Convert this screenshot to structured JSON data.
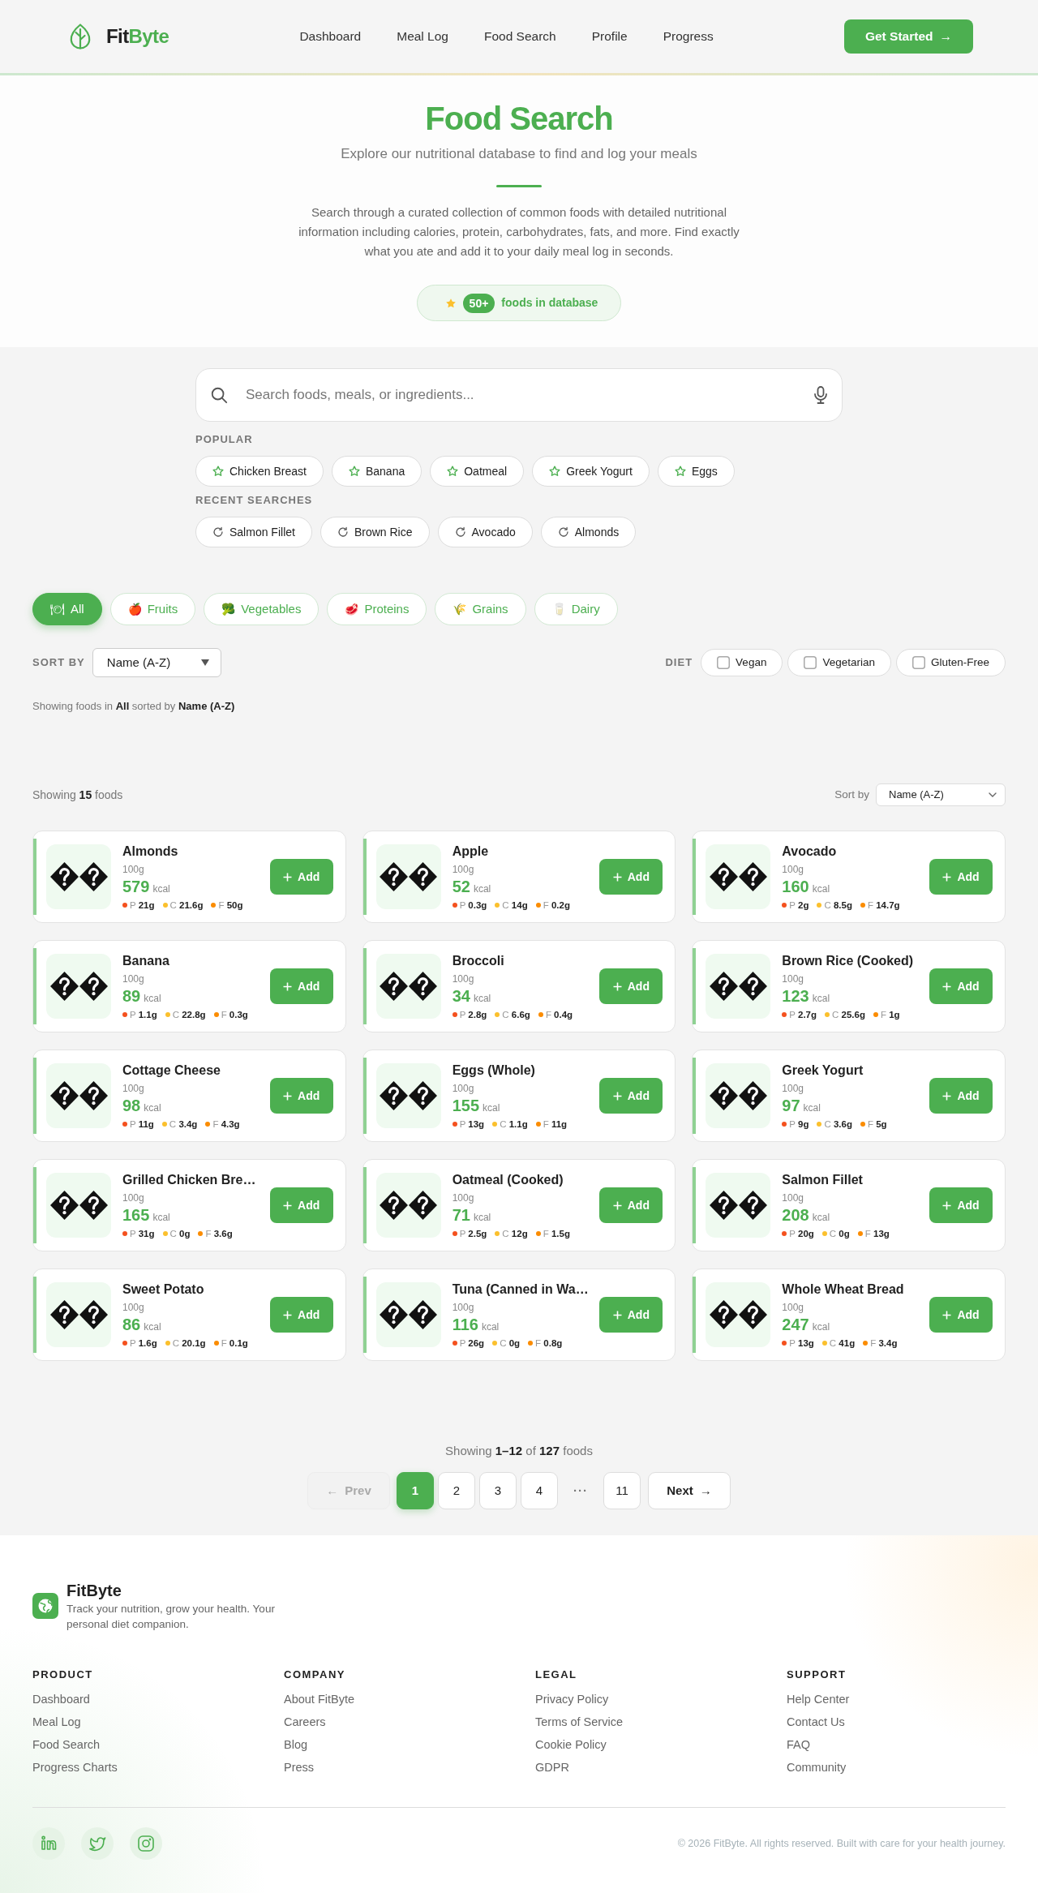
{
  "navbar": {
    "brand": {
      "prefix": "Fit",
      "accent": "Byte"
    },
    "links": [
      "Dashboard",
      "Meal Log",
      "Food Search",
      "Profile",
      "Progress"
    ],
    "cta": {
      "label": "Get Started",
      "arrow": "→"
    }
  },
  "hero": {
    "title": "Food Search",
    "subtitle": "Explore our nutritional database to find and log your meals",
    "description": "Search through a curated collection of common foods with detailed nutritional information including calories, protein, carbohydrates, fats, and more. Find exactly what you ate and add it to your daily meal log in seconds.",
    "badge": {
      "count": "50+",
      "label": "foods in database"
    }
  },
  "search": {
    "placeholder": "Search foods, meals, or ingredients..."
  },
  "popular": {
    "heading": "POPULAR",
    "items": [
      "Chicken Breast",
      "Banana",
      "Oatmeal",
      "Greek Yogurt",
      "Eggs"
    ]
  },
  "recent": {
    "heading": "RECENT SEARCHES",
    "items": [
      "Salmon Fillet",
      "Brown Rice",
      "Avocado",
      "Almonds"
    ]
  },
  "categories": [
    {
      "emoji": "🍽",
      "label": "All",
      "selected": true
    },
    {
      "emoji": "🍎",
      "label": "Fruits",
      "selected": false
    },
    {
      "emoji": "🥦",
      "label": "Vegetables",
      "selected": false
    },
    {
      "emoji": "🥩",
      "label": "Proteins",
      "selected": false
    },
    {
      "emoji": "🌾",
      "label": "Grains",
      "selected": false
    },
    {
      "emoji": "🥛",
      "label": "Dairy",
      "selected": false
    }
  ],
  "sort": {
    "label": "SORT BY",
    "value": "Name (A-Z)"
  },
  "diet": {
    "label": "DIET",
    "options": [
      {
        "label": "Vegan",
        "checked": false
      },
      {
        "label": "Vegetarian",
        "checked": false
      },
      {
        "label": "Gluten-Free",
        "checked": false
      }
    ]
  },
  "summary": "Showing foods in **All** sorted by **Name (A-Z)**",
  "results": {
    "count": "Showing **15** foods",
    "sort_label": "Sort by",
    "sort_value": "Name (A-Z)"
  },
  "foods": [
    {
      "name": "Almonds",
      "serving": "100g",
      "kcal": "579",
      "unit": "kcal",
      "macros": [
        {
          "label": "P",
          "value": "21g",
          "color": "#f4511e"
        },
        {
          "label": "C",
          "value": "21.6g",
          "color": "#fbc02d"
        },
        {
          "label": "F",
          "value": "50g",
          "color": "#fb8c00"
        }
      ],
      "action": "Add"
    },
    {
      "name": "Apple",
      "serving": "100g",
      "kcal": "52",
      "unit": "kcal",
      "macros": [
        {
          "label": "P",
          "value": "0.3g",
          "color": "#f4511e"
        },
        {
          "label": "C",
          "value": "14g",
          "color": "#fbc02d"
        },
        {
          "label": "F",
          "value": "0.2g",
          "color": "#fb8c00"
        }
      ],
      "action": "Add"
    },
    {
      "name": "Avocado",
      "serving": "100g",
      "kcal": "160",
      "unit": "kcal",
      "macros": [
        {
          "label": "P",
          "value": "2g",
          "color": "#f4511e"
        },
        {
          "label": "C",
          "value": "8.5g",
          "color": "#fbc02d"
        },
        {
          "label": "F",
          "value": "14.7g",
          "color": "#fb8c00"
        }
      ],
      "action": "Add"
    },
    {
      "name": "Banana",
      "serving": "100g",
      "kcal": "89",
      "unit": "kcal",
      "macros": [
        {
          "label": "P",
          "value": "1.1g",
          "color": "#f4511e"
        },
        {
          "label": "C",
          "value": "22.8g",
          "color": "#fbc02d"
        },
        {
          "label": "F",
          "value": "0.3g",
          "color": "#fb8c00"
        }
      ],
      "action": "Add"
    },
    {
      "name": "Broccoli",
      "serving": "100g",
      "kcal": "34",
      "unit": "kcal",
      "macros": [
        {
          "label": "P",
          "value": "2.8g",
          "color": "#f4511e"
        },
        {
          "label": "C",
          "value": "6.6g",
          "color": "#fbc02d"
        },
        {
          "label": "F",
          "value": "0.4g",
          "color": "#fb8c00"
        }
      ],
      "action": "Add"
    },
    {
      "name": "Brown Rice (Cooked)",
      "serving": "100g",
      "kcal": "123",
      "unit": "kcal",
      "macros": [
        {
          "label": "P",
          "value": "2.7g",
          "color": "#f4511e"
        },
        {
          "label": "C",
          "value": "25.6g",
          "color": "#fbc02d"
        },
        {
          "label": "F",
          "value": "1g",
          "color": "#fb8c00"
        }
      ],
      "action": "Add"
    },
    {
      "name": "Cottage Cheese",
      "serving": "100g",
      "kcal": "98",
      "unit": "kcal",
      "macros": [
        {
          "label": "P",
          "value": "11g",
          "color": "#f4511e"
        },
        {
          "label": "C",
          "value": "3.4g",
          "color": "#fbc02d"
        },
        {
          "label": "F",
          "value": "4.3g",
          "color": "#fb8c00"
        }
      ],
      "action": "Add"
    },
    {
      "name": "Eggs (Whole)",
      "serving": "100g",
      "kcal": "155",
      "unit": "kcal",
      "macros": [
        {
          "label": "P",
          "value": "13g",
          "color": "#f4511e"
        },
        {
          "label": "C",
          "value": "1.1g",
          "color": "#fbc02d"
        },
        {
          "label": "F",
          "value": "11g",
          "color": "#fb8c00"
        }
      ],
      "action": "Add"
    },
    {
      "name": "Greek Yogurt",
      "serving": "100g",
      "kcal": "97",
      "unit": "kcal",
      "macros": [
        {
          "label": "P",
          "value": "9g",
          "color": "#f4511e"
        },
        {
          "label": "C",
          "value": "3.6g",
          "color": "#fbc02d"
        },
        {
          "label": "F",
          "value": "5g",
          "color": "#fb8c00"
        }
      ],
      "action": "Add"
    },
    {
      "name": "Grilled Chicken Bre…",
      "serving": "100g",
      "kcal": "165",
      "unit": "kcal",
      "macros": [
        {
          "label": "P",
          "value": "31g",
          "color": "#f4511e"
        },
        {
          "label": "C",
          "value": "0g",
          "color": "#fbc02d"
        },
        {
          "label": "F",
          "value": "3.6g",
          "color": "#fb8c00"
        }
      ],
      "action": "Add"
    },
    {
      "name": "Oatmeal (Cooked)",
      "serving": "100g",
      "kcal": "71",
      "unit": "kcal",
      "macros": [
        {
          "label": "P",
          "value": "2.5g",
          "color": "#f4511e"
        },
        {
          "label": "C",
          "value": "12g",
          "color": "#fbc02d"
        },
        {
          "label": "F",
          "value": "1.5g",
          "color": "#fb8c00"
        }
      ],
      "action": "Add"
    },
    {
      "name": "Salmon Fillet",
      "serving": "100g",
      "kcal": "208",
      "unit": "kcal",
      "macros": [
        {
          "label": "P",
          "value": "20g",
          "color": "#f4511e"
        },
        {
          "label": "C",
          "value": "0g",
          "color": "#fbc02d"
        },
        {
          "label": "F",
          "value": "13g",
          "color": "#fb8c00"
        }
      ],
      "action": "Add"
    },
    {
      "name": "Sweet Potato",
      "serving": "100g",
      "kcal": "86",
      "unit": "kcal",
      "macros": [
        {
          "label": "P",
          "value": "1.6g",
          "color": "#f4511e"
        },
        {
          "label": "C",
          "value": "20.1g",
          "color": "#fbc02d"
        },
        {
          "label": "F",
          "value": "0.1g",
          "color": "#fb8c00"
        }
      ],
      "action": "Add"
    },
    {
      "name": "Tuna (Canned in Wa…",
      "serving": "100g",
      "kcal": "116",
      "unit": "kcal",
      "macros": [
        {
          "label": "P",
          "value": "26g",
          "color": "#f4511e"
        },
        {
          "label": "C",
          "value": "0g",
          "color": "#fbc02d"
        },
        {
          "label": "F",
          "value": "0.8g",
          "color": "#fb8c00"
        }
      ],
      "action": "Add"
    },
    {
      "name": "Whole Wheat Bread",
      "serving": "100g",
      "kcal": "247",
      "unit": "kcal",
      "macros": [
        {
          "label": "P",
          "value": "13g",
          "color": "#f4511e"
        },
        {
          "label": "C",
          "value": "41g",
          "color": "#fbc02d"
        },
        {
          "label": "F",
          "value": "3.4g",
          "color": "#fb8c00"
        }
      ],
      "action": "Add"
    }
  ],
  "pagination": {
    "range": "Showing **1–12** of **127** foods",
    "prev": {
      "arrow": "←",
      "label": "Prev",
      "disabled": true
    },
    "pages": [
      {
        "label": "1",
        "selected": true
      },
      {
        "label": "2",
        "selected": false
      },
      {
        "label": "3",
        "selected": false
      },
      {
        "label": "4",
        "selected": false
      }
    ],
    "gap": "···",
    "last_pages": [
      {
        "label": "11",
        "selected": false
      }
    ],
    "next": {
      "label": "Next",
      "arrow": "→",
      "disabled": false
    }
  },
  "footer": {
    "brand": "FitByte",
    "tagline": "Track your nutrition, grow your health. Your personal diet companion.",
    "columns": [
      {
        "heading": "PRODUCT",
        "links": [
          "Dashboard",
          "Meal Log",
          "Food Search",
          "Progress Charts"
        ]
      },
      {
        "heading": "COMPANY",
        "links": [
          "About FitByte",
          "Careers",
          "Blog",
          "Press"
        ]
      },
      {
        "heading": "LEGAL",
        "links": [
          "Privacy Policy",
          "Terms of Service",
          "Cookie Policy",
          "GDPR"
        ]
      },
      {
        "heading": "SUPPORT",
        "links": [
          "Help Center",
          "Contact Us",
          "FAQ",
          "Community"
        ]
      }
    ],
    "copyright": "© 2026 FitByte. All rights reserved. Built with care for your health journey."
  }
}
